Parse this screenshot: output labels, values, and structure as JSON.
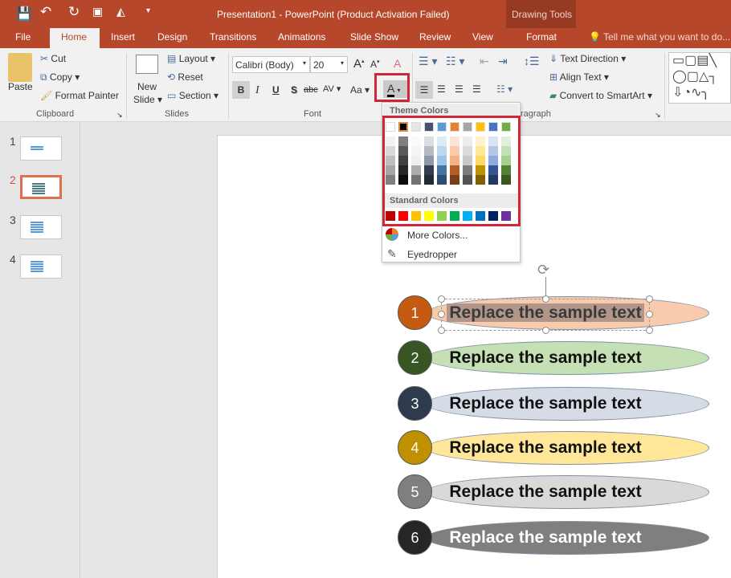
{
  "titlebar": {
    "title": "Presentation1 - PowerPoint (Product Activation Failed)",
    "context": "Drawing Tools"
  },
  "tabs": [
    "File",
    "Home",
    "Insert",
    "Design",
    "Transitions",
    "Animations",
    "Slide Show",
    "Review",
    "View",
    "Format"
  ],
  "tell_me": "Tell me what you want to do...",
  "ribbon": {
    "clipboard": {
      "paste": "Paste",
      "cut": "Cut",
      "copy": "Copy",
      "format_painter": "Format Painter",
      "label": "Clipboard"
    },
    "slides": {
      "new": "New",
      "slide": "Slide",
      "layout": "Layout",
      "reset": "Reset",
      "section": "Section",
      "label": "Slides"
    },
    "font": {
      "font_name": "Calibri (Body)",
      "font_size": "20",
      "label": "Font",
      "bold": "B",
      "italic": "I",
      "underline": "U",
      "shadow": "S",
      "strike": "abc",
      "spacing": "AV",
      "case": "Aa"
    },
    "paragraph": {
      "label": "ragraph",
      "text_direction": "Text Direction",
      "align_text": "Align Text",
      "smartart": "Convert to SmartArt"
    }
  },
  "color_menu": {
    "theme_label": "Theme Colors",
    "standard_label": "Standard Colors",
    "more": "More Colors...",
    "eyedropper": "Eyedropper",
    "theme_colors": [
      "#ffffff",
      "#000000",
      "#e7e6e6",
      "#44546a",
      "#5b9bd5",
      "#ed7d31",
      "#a5a5a5",
      "#ffc000",
      "#4472c4",
      "#70ad47"
    ],
    "selected": "#000000",
    "standard_colors": [
      "#c00000",
      "#ff0000",
      "#ffc000",
      "#ffff00",
      "#92d050",
      "#00b050",
      "#00b0f0",
      "#0070c0",
      "#002060",
      "#7030a0"
    ]
  },
  "slides_pane": [
    {
      "num": "1"
    },
    {
      "num": "2",
      "active": true
    },
    {
      "num": "3"
    },
    {
      "num": "4"
    }
  ],
  "slide_items": [
    {
      "num": "1",
      "text": "Replace the sample text",
      "circle": "#c55a11",
      "fill": "#f8cbad",
      "selected": true
    },
    {
      "num": "2",
      "text": "Replace the sample text",
      "circle": "#375623",
      "fill": "#c5e0b4"
    },
    {
      "num": "3",
      "text": "Replace the sample text",
      "circle": "#2e3a4e",
      "fill": "#d6dce5"
    },
    {
      "num": "4",
      "text": "Replace the sample text",
      "circle": "#bf9000",
      "fill": "#ffe699"
    },
    {
      "num": "5",
      "text": "Replace the sample text",
      "circle": "#7f7f7f",
      "fill": "#d9d9d9"
    },
    {
      "num": "6",
      "text": "Replace the sample text",
      "circle": "#262626",
      "fill": "#7f7f7f",
      "light_text": true
    }
  ]
}
